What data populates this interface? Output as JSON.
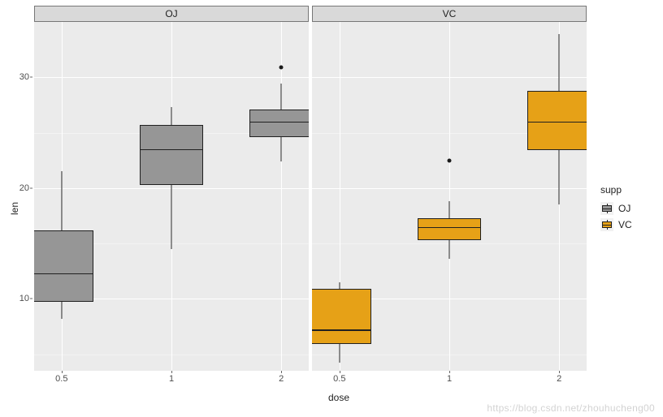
{
  "xlabel": "dose",
  "ylabel": "len",
  "legend": {
    "title": "supp",
    "items": [
      "OJ",
      "VC"
    ]
  },
  "facets": [
    "OJ",
    "VC"
  ],
  "x_categories": [
    "0.5",
    "1",
    "2"
  ],
  "y_ticks": [
    10,
    20,
    30
  ],
  "y_range": [
    3.5,
    35
  ],
  "colors": {
    "OJ": "#969696",
    "VC": "#E6A117"
  },
  "watermark": "https://blog.csdn.net/zhouhucheng00",
  "chart_data": {
    "type": "boxplot",
    "xlabel": "dose",
    "ylabel": "len",
    "ylim": [
      3.5,
      35
    ],
    "x_categories": [
      "0.5",
      "1",
      "2"
    ],
    "facet_by": "supp",
    "fill_by": "supp",
    "colors": {
      "OJ": "#969696",
      "VC": "#E6A117"
    },
    "series": [
      {
        "facet": "OJ",
        "supp": "OJ",
        "boxes": [
          {
            "x": "0.5",
            "min": 8.2,
            "q1": 9.7,
            "median": 12.3,
            "q3": 16.2,
            "max": 21.5,
            "outliers": []
          },
          {
            "x": "1",
            "min": 14.5,
            "q1": 20.3,
            "median": 23.5,
            "q3": 25.7,
            "max": 27.3,
            "outliers": []
          },
          {
            "x": "2",
            "min": 22.4,
            "q1": 24.6,
            "median": 26.0,
            "q3": 27.1,
            "max": 29.4,
            "outliers": [
              30.9
            ]
          }
        ]
      },
      {
        "facet": "VC",
        "supp": "VC",
        "boxes": [
          {
            "x": "0.5",
            "min": 4.2,
            "q1": 5.9,
            "median": 7.2,
            "q3": 10.9,
            "max": 11.5,
            "outliers": []
          },
          {
            "x": "1",
            "min": 13.6,
            "q1": 15.3,
            "median": 16.5,
            "q3": 17.3,
            "max": 18.8,
            "outliers": [
              22.5
            ]
          },
          {
            "x": "2",
            "min": 18.5,
            "q1": 23.4,
            "median": 26.0,
            "q3": 28.8,
            "max": 33.9,
            "outliers": []
          }
        ]
      }
    ]
  }
}
